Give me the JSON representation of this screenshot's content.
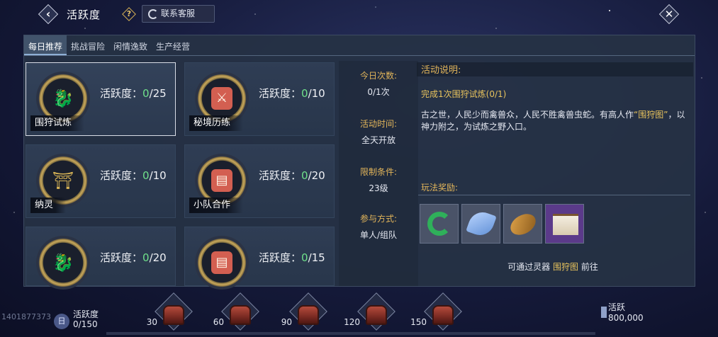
{
  "header": {
    "title": "活跃度",
    "help_symbol": "?",
    "service_label": "联系客服",
    "back_symbol": "‹",
    "close_symbol": "✕"
  },
  "tabs": [
    {
      "label": "每日推荐",
      "active": true
    },
    {
      "label": "挑战冒险",
      "active": false
    },
    {
      "label": "闲情逸致",
      "active": false
    },
    {
      "label": "生产经营",
      "active": false
    }
  ],
  "activity_label": "活跃度：",
  "activities": [
    {
      "name": "围狩试炼",
      "current": "0",
      "max": "/25",
      "icon": "beast-icon",
      "glyph": "🐉"
    },
    {
      "name": "秘境历练",
      "current": "0",
      "max": "/10",
      "icon": "swords-icon",
      "glyph": "⚔"
    },
    {
      "name": "纳灵",
      "current": "0",
      "max": "/10",
      "icon": "spirit-icon",
      "glyph": "⛩"
    },
    {
      "name": "小队合作",
      "current": "0",
      "max": "/20",
      "icon": "calendar-icon",
      "glyph": "▤"
    },
    {
      "name": "",
      "current": "0",
      "max": "/20",
      "icon": "beast-icon",
      "glyph": "🐉"
    },
    {
      "name": "",
      "current": "0",
      "max": "/15",
      "icon": "calendar-icon",
      "glyph": "▤"
    }
  ],
  "info": {
    "times_label": "今日次数:",
    "times_value": "0/1次",
    "time_label": "活动时间:",
    "time_value": "全天开放",
    "limit_label": "限制条件:",
    "limit_value": "23级",
    "mode_label": "参与方式:",
    "mode_value": "单人/组队"
  },
  "detail": {
    "heading": "活动说明:",
    "task": "完成1次围狩试炼(0/1)",
    "desc_before": "古之世，人民少而禽兽众，人民不胜禽兽虫蛇。有高人作",
    "desc_highlight": "“围狩图”",
    "desc_after": "，以神力附之，为试炼之野入口。",
    "reward_label": "玩法奖励:",
    "rewards": [
      "jade-ring-icon",
      "blue-crystal-icon",
      "amber-shell-icon",
      "scroll-painting-icon"
    ],
    "hint_before": "可通过灵器 ",
    "hint_highlight": "围狩图",
    "hint_after": " 前往"
  },
  "bottom": {
    "uid": "1401877373",
    "icon_text": "日",
    "label_line1": "活跃度",
    "label_line2": "0/150",
    "milestones": [
      "30",
      "60",
      "90",
      "120",
      "150"
    ],
    "right_line1": "活跃",
    "right_line2": "800,000"
  }
}
